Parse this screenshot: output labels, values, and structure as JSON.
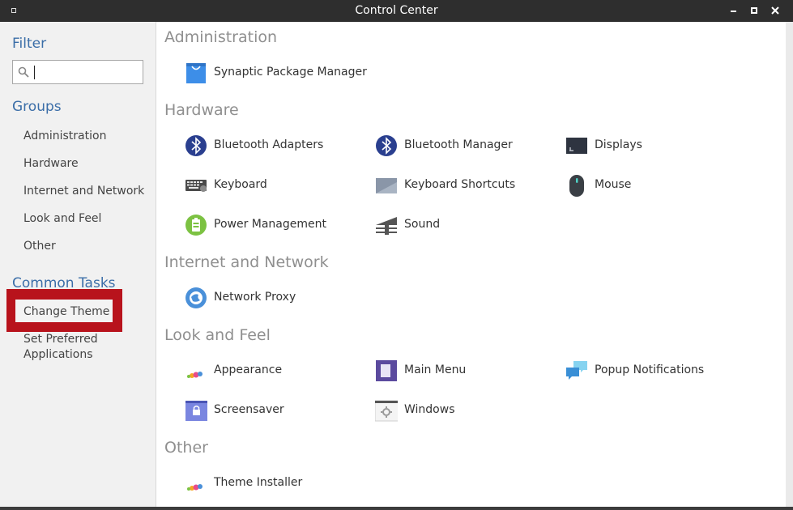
{
  "window": {
    "title": "Control Center"
  },
  "sidebar": {
    "filter_heading": "Filter",
    "search_value": "",
    "groups_heading": "Groups",
    "groups": [
      "Administration",
      "Hardware",
      "Internet and Network",
      "Look and Feel",
      "Other"
    ],
    "tasks_heading": "Common Tasks",
    "tasks": [
      "Change Theme",
      "Set Preferred Applications"
    ],
    "highlight_color": "#b8131c"
  },
  "main": {
    "sections": [
      {
        "title": "Administration",
        "items": [
          {
            "label": "Synaptic Package Manager",
            "icon": "package-icon"
          }
        ]
      },
      {
        "title": "Hardware",
        "items": [
          {
            "label": "Bluetooth Adapters",
            "icon": "bluetooth-icon"
          },
          {
            "label": "Bluetooth Manager",
            "icon": "bluetooth-icon"
          },
          {
            "label": "Displays",
            "icon": "display-icon"
          },
          {
            "label": "Keyboard",
            "icon": "keyboard-icon"
          },
          {
            "label": "Keyboard Shortcuts",
            "icon": "keyboard-shortcuts-icon"
          },
          {
            "label": "Mouse",
            "icon": "mouse-icon"
          },
          {
            "label": "Power Management",
            "icon": "battery-icon"
          },
          {
            "label": "Sound",
            "icon": "sound-icon"
          }
        ]
      },
      {
        "title": "Internet and Network",
        "items": [
          {
            "label": "Network Proxy",
            "icon": "globe-icon"
          }
        ]
      },
      {
        "title": "Look and Feel",
        "items": [
          {
            "label": "Appearance",
            "icon": "appearance-icon"
          },
          {
            "label": "Main Menu",
            "icon": "main-menu-icon"
          },
          {
            "label": "Popup Notifications",
            "icon": "notifications-icon"
          },
          {
            "label": "Screensaver",
            "icon": "screensaver-icon"
          },
          {
            "label": "Windows",
            "icon": "windows-icon"
          }
        ]
      },
      {
        "title": "Other",
        "items": [
          {
            "label": "Theme Installer",
            "icon": "theme-installer-icon"
          }
        ]
      }
    ]
  }
}
